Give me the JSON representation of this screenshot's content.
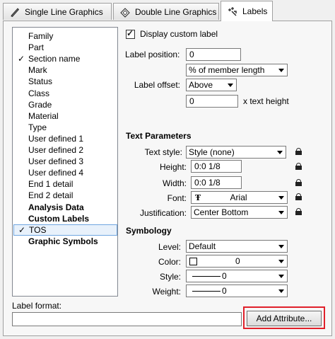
{
  "tabs": [
    {
      "label": "Single Line Graphics",
      "icon": "pencil-icon"
    },
    {
      "label": "Double Line Graphics",
      "icon": "eraser-icon"
    },
    {
      "label": "Labels",
      "icon": "label-cursor-icon"
    }
  ],
  "list": {
    "items": [
      {
        "label": "Family",
        "checked": false,
        "bold": false
      },
      {
        "label": "Part",
        "checked": false,
        "bold": false
      },
      {
        "label": "Section name",
        "checked": true,
        "bold": false
      },
      {
        "label": "Mark",
        "checked": false,
        "bold": false
      },
      {
        "label": "Status",
        "checked": false,
        "bold": false
      },
      {
        "label": "Class",
        "checked": false,
        "bold": false
      },
      {
        "label": "Grade",
        "checked": false,
        "bold": false
      },
      {
        "label": "Material",
        "checked": false,
        "bold": false
      },
      {
        "label": "Type",
        "checked": false,
        "bold": false
      },
      {
        "label": "User defined 1",
        "checked": false,
        "bold": false
      },
      {
        "label": "User defined 2",
        "checked": false,
        "bold": false
      },
      {
        "label": "User defined 3",
        "checked": false,
        "bold": false
      },
      {
        "label": "User defined 4",
        "checked": false,
        "bold": false
      },
      {
        "label": "End 1 detail",
        "checked": false,
        "bold": false
      },
      {
        "label": "End 2 detail",
        "checked": false,
        "bold": false
      },
      {
        "label": "Analysis Data",
        "checked": false,
        "bold": true
      },
      {
        "label": "Custom Labels",
        "checked": false,
        "bold": true
      },
      {
        "label": "TOS",
        "checked": true,
        "bold": false,
        "selected": true
      },
      {
        "label": "Graphic Symbols",
        "checked": false,
        "bold": true
      }
    ]
  },
  "label_options": {
    "display_custom_label": "Display custom label",
    "display_checked": true,
    "position_label": "Label position:",
    "position_value": "0",
    "position_unit": "% of member length",
    "offset_label": "Label offset:",
    "offset_value": "Above",
    "offset_amount": "0",
    "offset_unit": "x text height"
  },
  "text_parameters": {
    "heading": "Text Parameters",
    "style_label": "Text style:",
    "style_value": "Style (none)",
    "height_label": "Height:",
    "height_value": "0:0 1/8",
    "width_label": "Width:",
    "width_value": "0:0 1/8",
    "font_label": "Font:",
    "font_value": "Arial",
    "justification_label": "Justification:",
    "justification_value": "Center Bottom"
  },
  "symbology": {
    "heading": "Symbology",
    "level_label": "Level:",
    "level_value": "Default",
    "color_label": "Color:",
    "color_value": "0",
    "style_label": "Style:",
    "style_value": "0",
    "weight_label": "Weight:",
    "weight_value": "0"
  },
  "label_format": {
    "label": "Label format:",
    "value": "",
    "add_button": "Add Attribute..."
  },
  "colors": {
    "highlight": "#e0202a",
    "selection": "#e8f1fb"
  }
}
